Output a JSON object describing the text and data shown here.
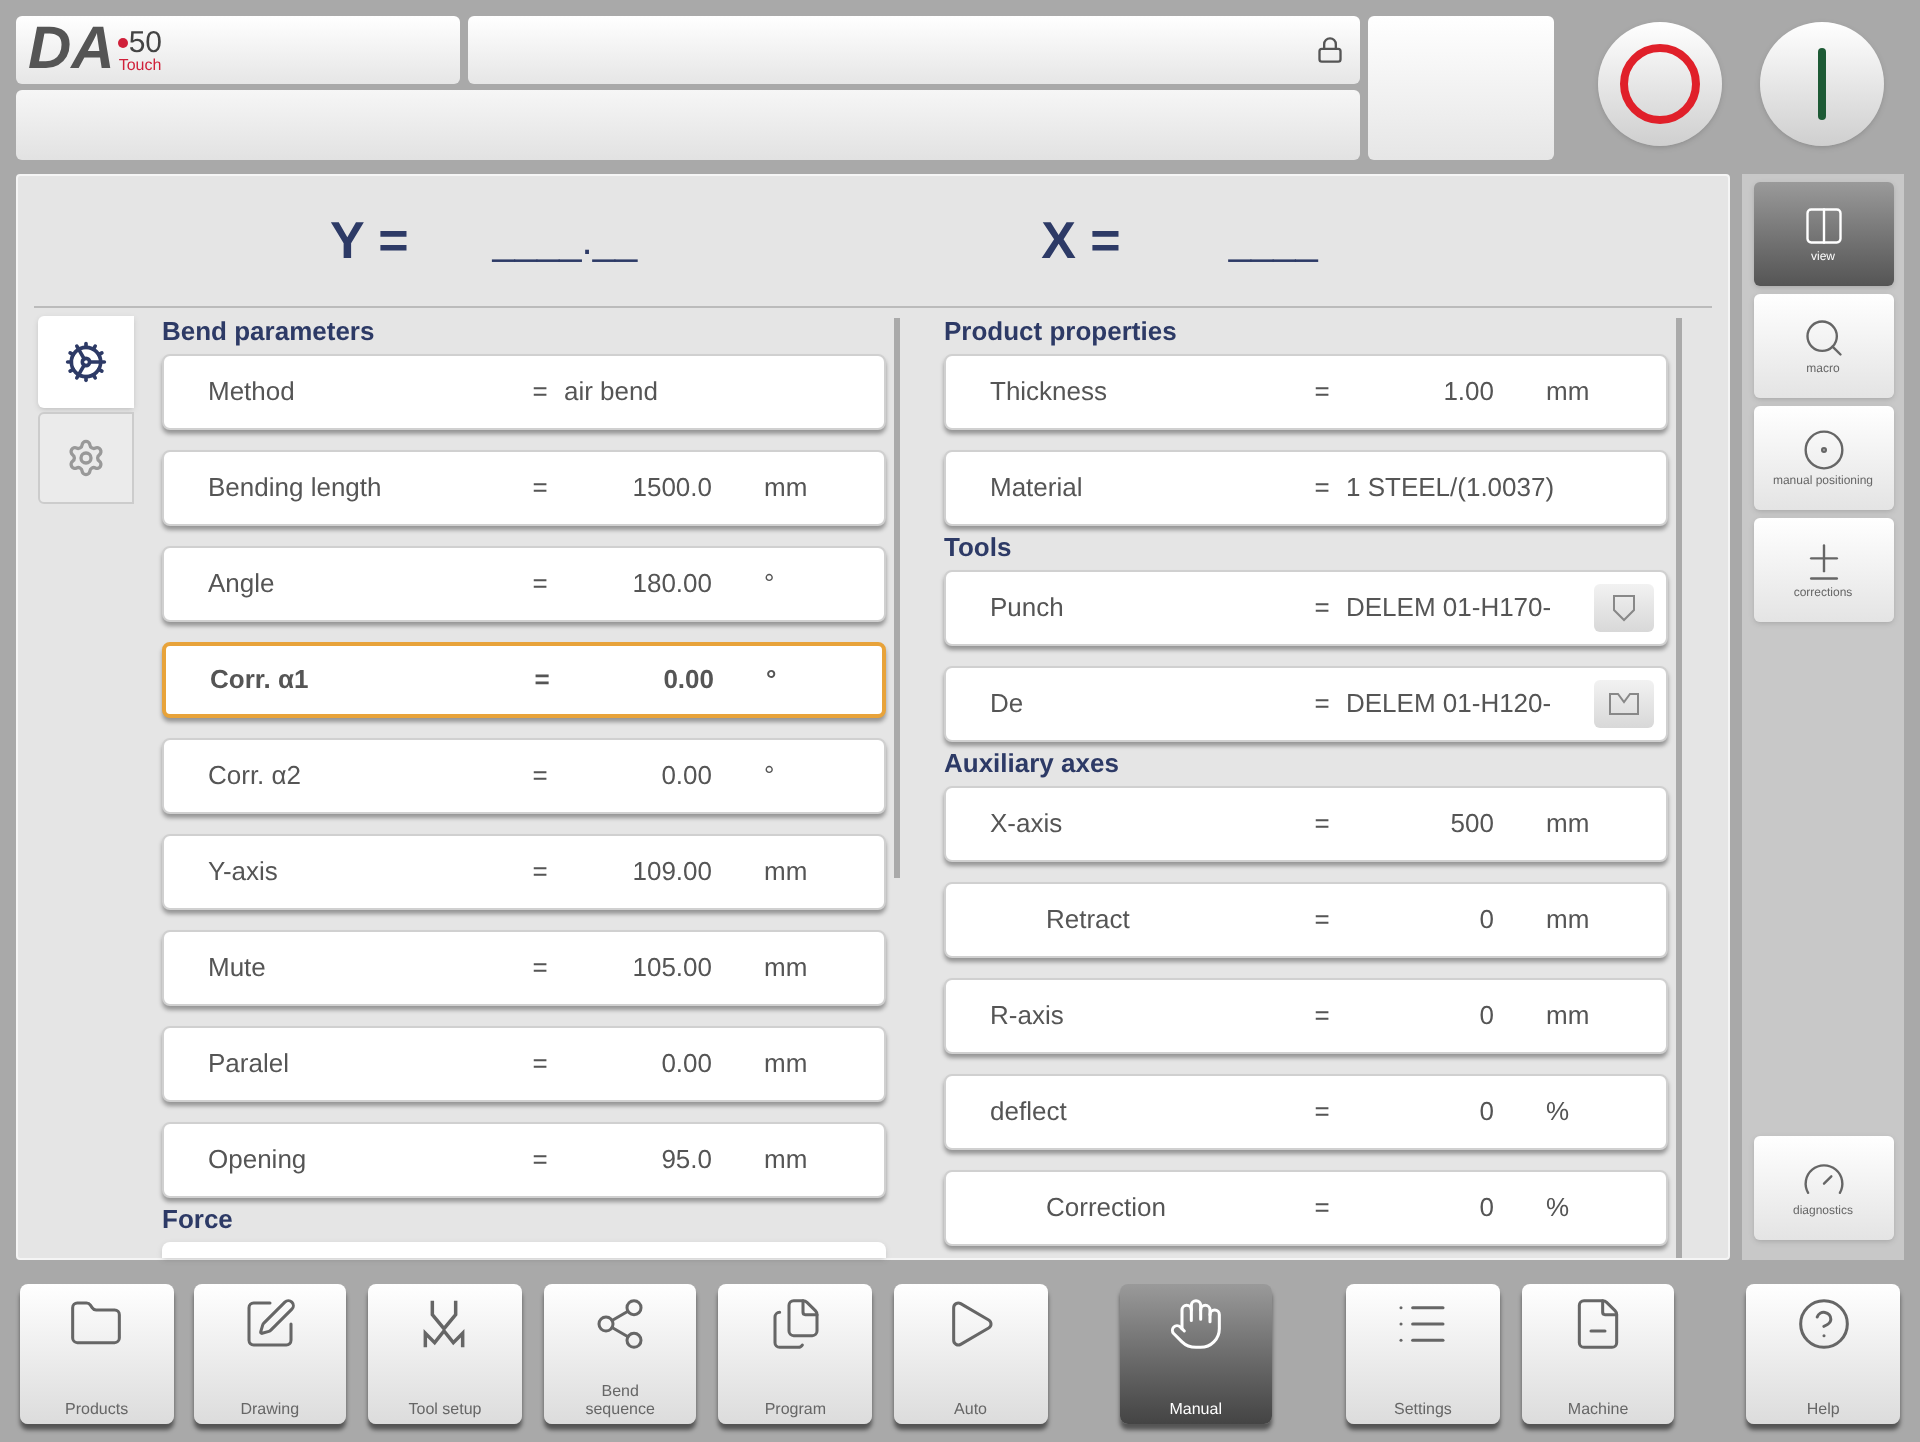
{
  "logo": {
    "letters": "DA",
    "model": "50",
    "edition": "Touch"
  },
  "header": {
    "y_label": "Y =",
    "y_value": "____.__",
    "x_label": "X =",
    "x_value": "____"
  },
  "left_tabs": [
    {
      "selected": true
    },
    {
      "selected": false
    }
  ],
  "left_column": {
    "sections": [
      {
        "title": "Bend parameters",
        "rows": [
          {
            "kind": "text",
            "label": "Method",
            "eq": "=",
            "value": "air bend",
            "selected": false
          },
          {
            "kind": "number",
            "label": "Bending length",
            "eq": "=",
            "value": "1500.0",
            "unit": "mm",
            "selected": false
          },
          {
            "kind": "number",
            "label": "Angle",
            "eq": "=",
            "value": "180.00",
            "unit": "°",
            "selected": false
          },
          {
            "kind": "number",
            "label": "Corr. α1",
            "eq": "=",
            "value": "0.00",
            "unit": "°",
            "selected": true
          },
          {
            "kind": "number",
            "label": "Corr. α2",
            "eq": "=",
            "value": "0.00",
            "unit": "°",
            "selected": false
          },
          {
            "kind": "number",
            "label": "Y-axis",
            "eq": "=",
            "value": "109.00",
            "unit": "mm",
            "selected": false
          },
          {
            "kind": "number",
            "label": "Mute",
            "eq": "=",
            "value": "105.00",
            "unit": "mm",
            "selected": false
          },
          {
            "kind": "number",
            "label": "Paralel",
            "eq": "=",
            "value": "0.00",
            "unit": "mm",
            "selected": false
          },
          {
            "kind": "number",
            "label": "Opening",
            "eq": "=",
            "value": "95.0",
            "unit": "mm",
            "selected": false
          }
        ]
      },
      {
        "title": "Force",
        "rows": [
          {
            "kind": "cut"
          }
        ]
      }
    ]
  },
  "right_column": {
    "sections": [
      {
        "title": "Product properties",
        "rows": [
          {
            "kind": "number",
            "label": "Thickness",
            "eq": "=",
            "value": "1.00",
            "unit": "mm",
            "selected": false
          },
          {
            "kind": "text",
            "label": "Material",
            "eq": "=",
            "value": "1 STEEL/(1.0037)",
            "selected": false
          }
        ]
      },
      {
        "title": "Tools",
        "rows": [
          {
            "kind": "tool",
            "label": "Punch",
            "eq": "=",
            "value": "DELEM 01-H170-",
            "selected": false
          },
          {
            "kind": "tool",
            "label": "De",
            "eq": "=",
            "value": "DELEM 01-H120-",
            "selected": false
          }
        ]
      },
      {
        "title": "Auxiliary axes",
        "rows": [
          {
            "kind": "number",
            "label": "X-axis",
            "eq": "=",
            "value": "500",
            "unit": "mm",
            "selected": false
          },
          {
            "kind": "sub",
            "label": "Retract",
            "eq": "=",
            "value": "0",
            "unit": "mm",
            "selected": false
          },
          {
            "kind": "number",
            "label": "R-axis",
            "eq": "=",
            "value": "0",
            "unit": "mm",
            "selected": false
          },
          {
            "kind": "number",
            "label": "deflect",
            "eq": "=",
            "value": "0",
            "unit": "%",
            "selected": false
          },
          {
            "kind": "sub",
            "label": "Correction",
            "eq": "=",
            "value": "0",
            "unit": "%",
            "selected": false
          }
        ]
      }
    ]
  },
  "side_buttons": [
    {
      "label": "view",
      "selected": true
    },
    {
      "label": "macro",
      "selected": false
    },
    {
      "label": "manual positioning",
      "selected": false
    },
    {
      "label": "corrections",
      "selected": false
    }
  ],
  "side_bottom": {
    "label": "diagnostics",
    "selected": false
  },
  "nav": [
    {
      "label": "Products",
      "selected": false
    },
    {
      "label": "Drawing",
      "selected": false
    },
    {
      "label": "Tool setup",
      "selected": false
    },
    {
      "label": "Bend sequence",
      "selected": false
    },
    {
      "label": "Program",
      "selected": false
    },
    {
      "label": "Auto",
      "selected": false
    },
    {
      "label": "Manual",
      "selected": true
    },
    {
      "label": "Settings",
      "selected": false
    },
    {
      "label": "Machine",
      "selected": false
    },
    {
      "label": "Help",
      "selected": false
    }
  ]
}
